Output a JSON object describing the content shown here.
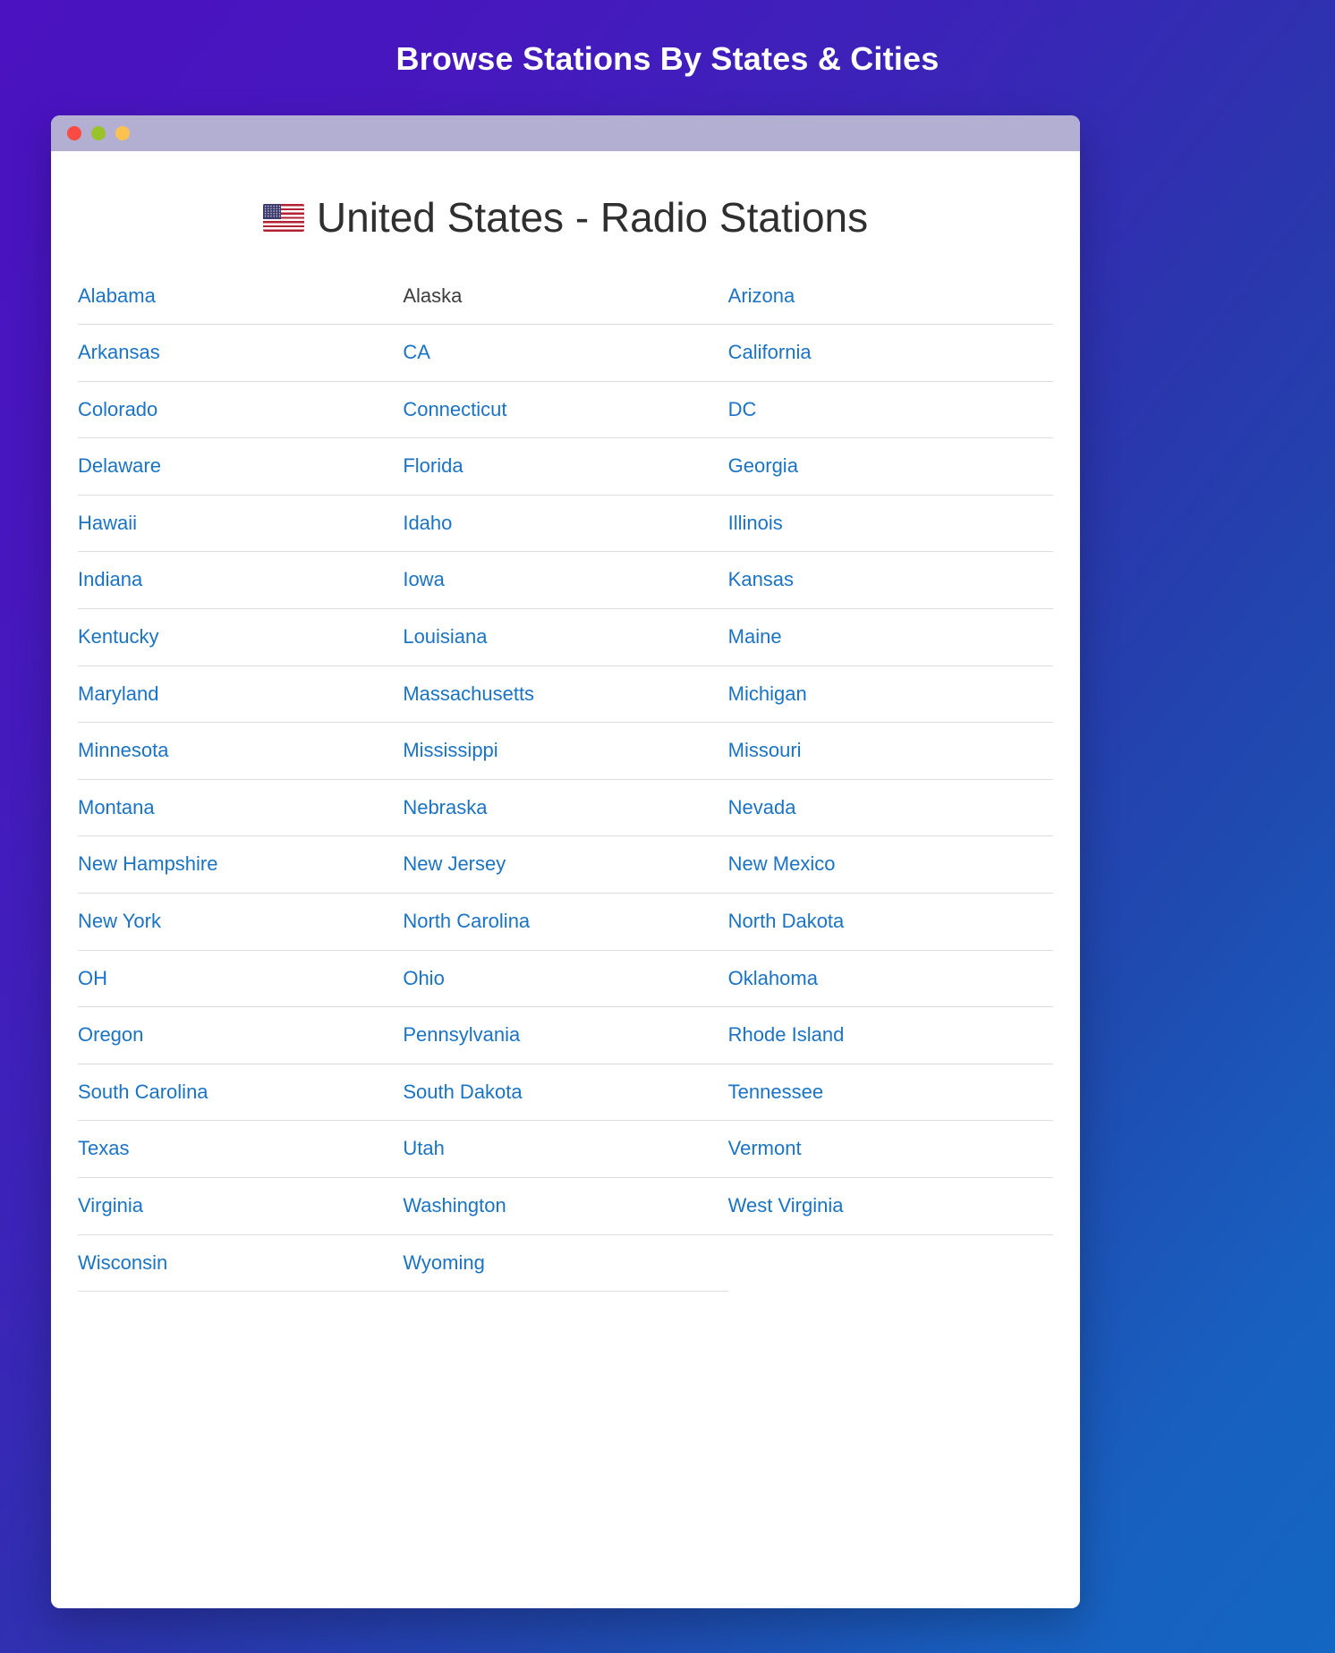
{
  "banner": {
    "title": "Browse Stations By States & Cities"
  },
  "window": {
    "controls": [
      {
        "name": "close",
        "color": "#f94b41"
      },
      {
        "name": "minimize",
        "color": "#9ac22b"
      },
      {
        "name": "maximize",
        "color": "#fcc251"
      }
    ]
  },
  "content": {
    "flag_icon": "us-flag-icon",
    "heading": "United States - Radio Stations",
    "columns": 3,
    "rows": [
      [
        {
          "label": "Alabama",
          "link": true
        },
        {
          "label": "Alaska",
          "link": false
        },
        {
          "label": "Arizona",
          "link": true
        }
      ],
      [
        {
          "label": "Arkansas",
          "link": true
        },
        {
          "label": "CA",
          "link": true
        },
        {
          "label": "California",
          "link": true
        }
      ],
      [
        {
          "label": "Colorado",
          "link": true
        },
        {
          "label": "Connecticut",
          "link": true
        },
        {
          "label": "DC",
          "link": true
        }
      ],
      [
        {
          "label": "Delaware",
          "link": true
        },
        {
          "label": "Florida",
          "link": true
        },
        {
          "label": "Georgia",
          "link": true
        }
      ],
      [
        {
          "label": "Hawaii",
          "link": true
        },
        {
          "label": "Idaho",
          "link": true
        },
        {
          "label": "Illinois",
          "link": true
        }
      ],
      [
        {
          "label": "Indiana",
          "link": true
        },
        {
          "label": "Iowa",
          "link": true
        },
        {
          "label": "Kansas",
          "link": true
        }
      ],
      [
        {
          "label": "Kentucky",
          "link": true
        },
        {
          "label": "Louisiana",
          "link": true
        },
        {
          "label": "Maine",
          "link": true
        }
      ],
      [
        {
          "label": "Maryland",
          "link": true
        },
        {
          "label": "Massachusetts",
          "link": true
        },
        {
          "label": "Michigan",
          "link": true
        }
      ],
      [
        {
          "label": "Minnesota",
          "link": true
        },
        {
          "label": "Mississippi",
          "link": true
        },
        {
          "label": "Missouri",
          "link": true
        }
      ],
      [
        {
          "label": "Montana",
          "link": true
        },
        {
          "label": "Nebraska",
          "link": true
        },
        {
          "label": "Nevada",
          "link": true
        }
      ],
      [
        {
          "label": "New Hampshire",
          "link": true
        },
        {
          "label": "New Jersey",
          "link": true
        },
        {
          "label": "New Mexico",
          "link": true
        }
      ],
      [
        {
          "label": "New York",
          "link": true
        },
        {
          "label": "North Carolina",
          "link": true
        },
        {
          "label": "North Dakota",
          "link": true
        }
      ],
      [
        {
          "label": "OH",
          "link": true
        },
        {
          "label": "Ohio",
          "link": true
        },
        {
          "label": "Oklahoma",
          "link": true
        }
      ],
      [
        {
          "label": "Oregon",
          "link": true
        },
        {
          "label": "Pennsylvania",
          "link": true
        },
        {
          "label": "Rhode Island",
          "link": true
        }
      ],
      [
        {
          "label": "South Carolina",
          "link": true
        },
        {
          "label": "South Dakota",
          "link": true
        },
        {
          "label": "Tennessee",
          "link": true
        }
      ],
      [
        {
          "label": "Texas",
          "link": true
        },
        {
          "label": "Utah",
          "link": true
        },
        {
          "label": "Vermont",
          "link": true
        }
      ],
      [
        {
          "label": "Virginia",
          "link": true
        },
        {
          "label": "Washington",
          "link": true
        },
        {
          "label": "West Virginia",
          "link": true
        }
      ],
      [
        {
          "label": "Wisconsin",
          "link": true
        },
        {
          "label": "Wyoming",
          "link": true
        },
        {
          "label": "",
          "link": false
        }
      ]
    ]
  },
  "colors": {
    "background_start": "#4a12c0",
    "background_end": "#1366c2",
    "titlebar": "#b2afd2",
    "link": "#1a73c4",
    "plain_text": "#3c3c3c",
    "heading": "#2f2f2f",
    "divider": "#dededf",
    "card": "#ffffff"
  }
}
